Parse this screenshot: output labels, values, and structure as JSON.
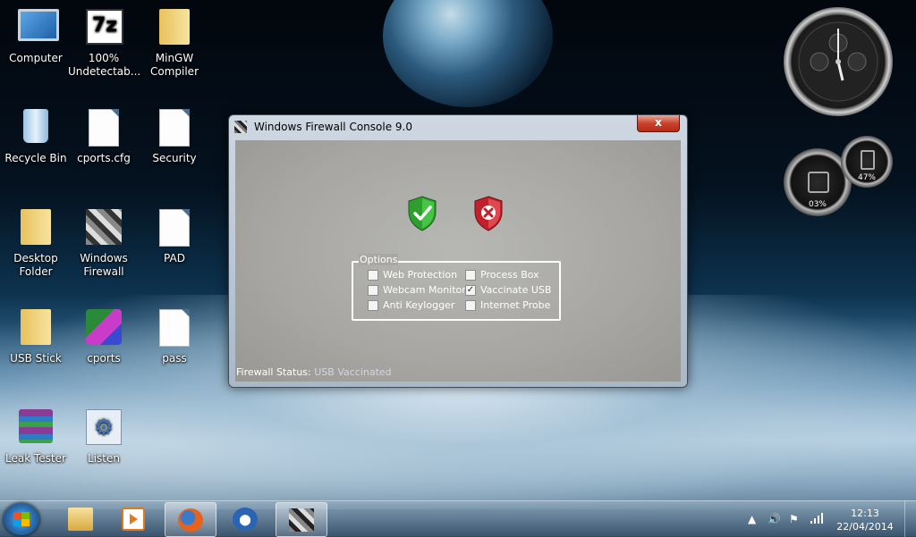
{
  "desktop": {
    "icons": [
      {
        "label": "Computer"
      },
      {
        "label": "100% Undetectab..."
      },
      {
        "label": "MinGW Compiler"
      },
      {
        "label": "Recycle Bin"
      },
      {
        "label": "cports.cfg"
      },
      {
        "label": "Security"
      },
      {
        "label": "Desktop Folder"
      },
      {
        "label": "Windows Firewall"
      },
      {
        "label": "PAD"
      },
      {
        "label": "USB Stick"
      },
      {
        "label": "cports"
      },
      {
        "label": "pass"
      },
      {
        "label": "Leak Tester"
      },
      {
        "label": "Listen"
      }
    ],
    "gadgets": {
      "cpu_percent": "03%",
      "memory_percent": "47%"
    }
  },
  "window": {
    "title": "Windows Firewall Console 9.0",
    "close_label": "x",
    "options_legend": "Options",
    "options": [
      {
        "label": "Web Protection",
        "checked": false
      },
      {
        "label": "Webcam Monitor",
        "checked": false
      },
      {
        "label": "Anti Keylogger",
        "checked": false
      },
      {
        "label": "Process Box",
        "checked": false
      },
      {
        "label": "Vaccinate USB",
        "checked": true
      },
      {
        "label": "Internet Probe",
        "checked": false
      }
    ],
    "status_label": "Firewall Status:",
    "status_value": "USB Vaccinated"
  },
  "taskbar": {
    "clock_time": "12:13",
    "clock_date": "22/04/2014",
    "pinned": [
      {
        "name": "Windows Explorer"
      },
      {
        "name": "Media Player"
      },
      {
        "name": "Firefox"
      },
      {
        "name": "Thunderbird"
      },
      {
        "name": "Windows Firewall Console"
      }
    ]
  },
  "colors": {
    "accept_shield": "#2e9e2e",
    "deny_shield": "#c2202a",
    "close_button": "#c9432c"
  },
  "icons": {
    "accept": "green-shield-check-icon",
    "deny": "red-shield-x-icon"
  }
}
